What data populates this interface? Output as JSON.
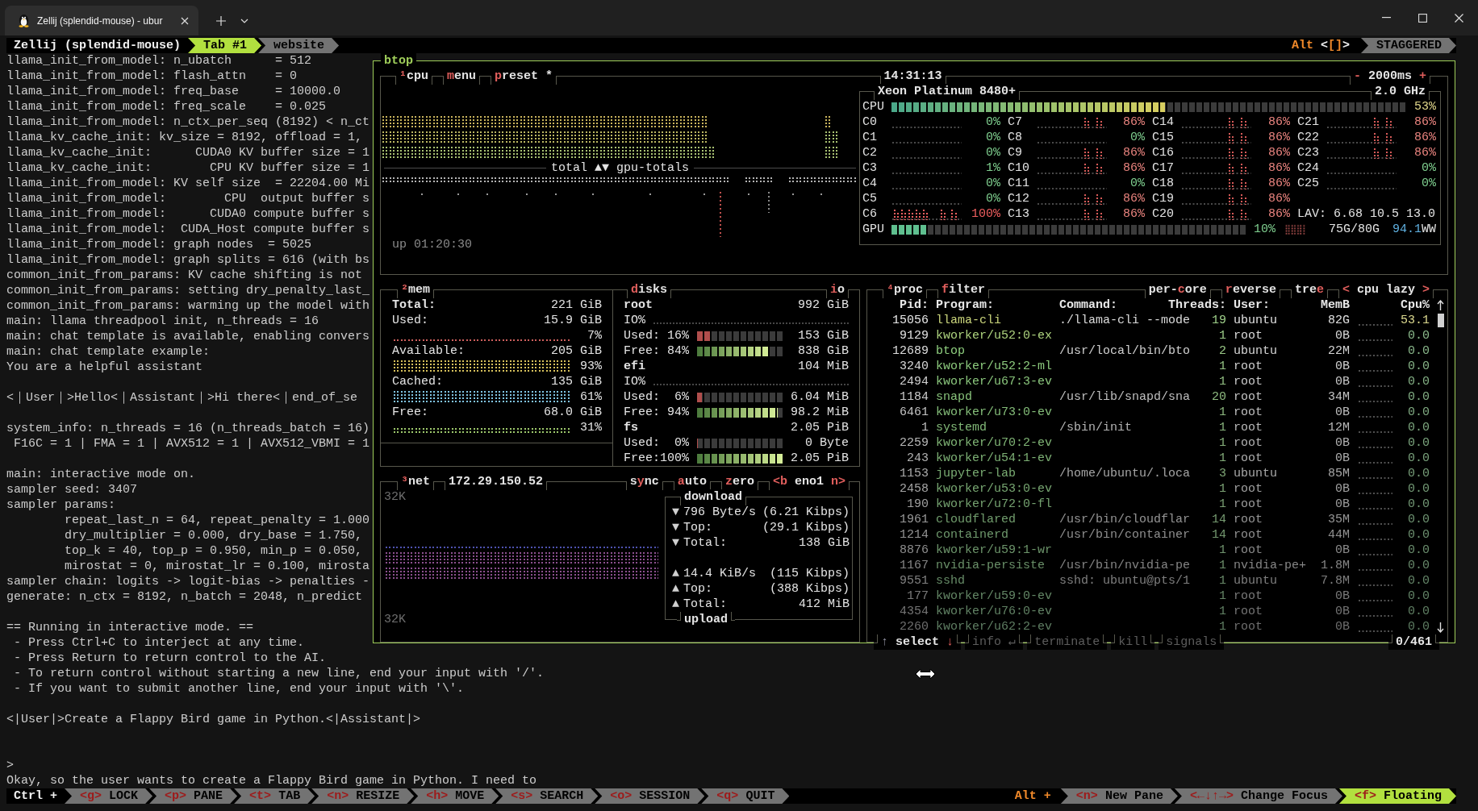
{
  "window": {
    "tab_title": "Zellij (splendid-mouse) - ubur"
  },
  "tab_bar": {
    "session": "Zellij (splendid-mouse)",
    "tabs": [
      {
        "label": "Tab #1",
        "selected": true
      },
      {
        "label": "website",
        "selected": false
      }
    ],
    "mode": "Alt",
    "swap_hint": [
      {
        "text": "<",
        "kind": "bracket"
      },
      {
        "text": "[]",
        "kind": "key"
      },
      {
        "text": ">",
        "kind": "bracket"
      }
    ],
    "layout": "STAGGERED"
  },
  "terminal": {
    "lines": [
      {
        "kind": "text",
        "text": "llama_init_from_model: n_ubatch      = 512"
      },
      {
        "kind": "text",
        "text": "llama_init_from_model: flash_attn    = 0"
      },
      {
        "kind": "text",
        "text": "llama_init_from_model: freq_base     = 10000.0"
      },
      {
        "kind": "text",
        "text": "llama_init_from_model: freq_scale    = 0.025"
      },
      {
        "kind": "text",
        "text": "llama_init_from_model: n_ctx_per_seq (8192) < n_ct"
      },
      {
        "kind": "text",
        "text": "llama_kv_cache_init: kv_size = 8192, offload = 1,"
      },
      {
        "kind": "text",
        "text": "llama_kv_cache_init:      CUDA0 KV buffer size = 1"
      },
      {
        "kind": "text",
        "text": "llama_kv_cache_init:        CPU KV buffer size = 1"
      },
      {
        "kind": "text",
        "text": "llama_init_from_model: KV self size  = 22204.00 Mi"
      },
      {
        "kind": "text",
        "text": "llama_init_from_model:        CPU  output buffer s"
      },
      {
        "kind": "text",
        "text": "llama_init_from_model:      CUDA0 compute buffer s"
      },
      {
        "kind": "text",
        "text": "llama_init_from_model:  CUDA_Host compute buffer s"
      },
      {
        "kind": "text",
        "text": "llama_init_from_model: graph nodes  = 5025"
      },
      {
        "kind": "text",
        "text": "llama_init_from_model: graph splits = 616 (with bs"
      },
      {
        "kind": "text",
        "text": "common_init_from_params: KV cache shifting is not"
      },
      {
        "kind": "text",
        "text": "common_init_from_params: setting dry_penalty_last_"
      },
      {
        "kind": "text",
        "text": "common_init_from_params: warming up the model with"
      },
      {
        "kind": "text",
        "text": "main: llama threadpool init, n_threads = 16"
      },
      {
        "kind": "text",
        "text": "main: chat template is available, enabling convers"
      },
      {
        "kind": "text",
        "text": "main: chat template example:"
      },
      {
        "kind": "text",
        "text": "You are a helpful assistant"
      },
      {
        "kind": "blank"
      },
      {
        "kind": "text",
        "text": "<｜User｜>Hello<｜Assistant｜>Hi there<｜end_of_se"
      },
      {
        "kind": "blank"
      },
      {
        "kind": "text",
        "text": "system_info: n_threads = 16 (n_threads_batch = 16)"
      },
      {
        "kind": "text",
        "text": " F16C = 1 | FMA = 1 | AVX512 = 1 | AVX512_VBMI = 1"
      },
      {
        "kind": "blank"
      },
      {
        "kind": "text",
        "text": "main: interactive mode on."
      },
      {
        "kind": "text",
        "text": "sampler seed: 3407"
      },
      {
        "kind": "text",
        "text": "sampler params:"
      },
      {
        "kind": "text",
        "text": "        repeat_last_n = 64, repeat_penalty = 1.000"
      },
      {
        "kind": "text",
        "text": "        dry_multiplier = 0.000, dry_base = 1.750,"
      },
      {
        "kind": "text",
        "text": "        top_k = 40, top_p = 0.950, min_p = 0.050,"
      },
      {
        "kind": "text",
        "text": "        mirostat = 0, mirostat_lr = 0.100, mirosta"
      },
      {
        "kind": "text",
        "text": "sampler chain: logits -> logit-bias -> penalties -"
      },
      {
        "kind": "text",
        "text": "generate: n_ctx = 8192, n_batch = 2048, n_predict"
      },
      {
        "kind": "blank"
      },
      {
        "kind": "text",
        "text": "== Running in interactive mode. =="
      },
      {
        "kind": "text",
        "text": " - Press Ctrl+C to interject at any time."
      },
      {
        "kind": "text",
        "text": " - Press Return to return control to the AI."
      },
      {
        "kind": "text",
        "text": " - To return control without starting a new line, end your input with '/'."
      },
      {
        "kind": "text",
        "text": " - If you want to submit another line, end your input with '\\'."
      },
      {
        "kind": "blank"
      },
      {
        "kind": "text",
        "text": "<|User|>Create a Flappy Bird game in Python.<|Assistant|>"
      },
      {
        "kind": "blank"
      },
      {
        "kind": "blank"
      },
      {
        "kind": "text",
        "text": ">"
      },
      {
        "kind": "text",
        "text": "Okay, so the user wants to create a Flappy Bird game in Python. I need to"
      }
    ]
  },
  "btop": {
    "title": "btop",
    "cpu": {
      "title": {
        "hotkey": "¹",
        "after": "cpu"
      },
      "menus": [
        {
          "hotkey": "m",
          "after": "enu"
        },
        {
          "hotkey": "p",
          "after": "reset *"
        }
      ],
      "clock": "14:31:13",
      "interval": {
        "minus": "-",
        "value": "2000ms",
        "plus": "+"
      },
      "graph_label": "total ▲▼ gpu-totals",
      "uptime": "up 01:20:30",
      "model": "Xeon Platinum 8480+",
      "frequency": "2.0 GHz",
      "total": {
        "label": "CPU",
        "level": 0.53,
        "reading": "53%"
      },
      "cores": [
        {
          "name": "C0",
          "reading": "0%",
          "kind": "idle"
        },
        {
          "name": "C1",
          "reading": "0%",
          "kind": "idle"
        },
        {
          "name": "C2",
          "reading": "0%",
          "kind": "idle"
        },
        {
          "name": "C3",
          "reading": "1%",
          "kind": "idle"
        },
        {
          "name": "C4",
          "reading": "0%",
          "kind": "idle"
        },
        {
          "name": "C5",
          "reading": "0%",
          "kind": "idle"
        },
        {
          "name": "C6",
          "reading": "100%",
          "kind": "full"
        },
        {
          "name": "C7",
          "reading": "86%",
          "kind": "busy"
        },
        {
          "name": "C8",
          "reading": "0%",
          "kind": "idle"
        },
        {
          "name": "C9",
          "reading": "86%",
          "kind": "busy"
        },
        {
          "name": "C10",
          "reading": "86%",
          "kind": "busy"
        },
        {
          "name": "C11",
          "reading": "0%",
          "kind": "idle"
        },
        {
          "name": "C12",
          "reading": "86%",
          "kind": "busy"
        },
        {
          "name": "C13",
          "reading": "86%",
          "kind": "busy"
        },
        {
          "name": "C14",
          "reading": "86%",
          "kind": "busy"
        },
        {
          "name": "C15",
          "reading": "86%",
          "kind": "busy"
        },
        {
          "name": "C16",
          "reading": "86%",
          "kind": "busy"
        },
        {
          "name": "C17",
          "reading": "86%",
          "kind": "busy"
        },
        {
          "name": "C18",
          "reading": "86%",
          "kind": "busy"
        },
        {
          "name": "C19",
          "reading": "86%",
          "kind": "busy"
        },
        {
          "name": "C20",
          "reading": "86%",
          "kind": "busy"
        },
        {
          "name": "C21",
          "reading": "86%",
          "kind": "busy"
        },
        {
          "name": "C22",
          "reading": "86%",
          "kind": "busy"
        },
        {
          "name": "C23",
          "reading": "86%",
          "kind": "busy"
        },
        {
          "name": "C24",
          "reading": "0%",
          "kind": "idle"
        },
        {
          "name": "C25",
          "reading": "0%",
          "kind": "idle"
        }
      ],
      "load_avg": "LAV: 6.68 10.5 13.0",
      "gpu": {
        "label": "GPU",
        "level": 0.1,
        "reading": "10%",
        "memory": "75G/80G",
        "power": "94.1",
        "power_unit": "WW"
      }
    },
    "mem": {
      "title": {
        "hotkey": "²",
        "after": "mem"
      },
      "items": [
        {
          "label": "Total:",
          "value": "221 GiB"
        },
        {
          "label": "Used:",
          "value": "15.9 GiB",
          "meter": {
            "reading": "7%",
            "kind": "low",
            "color": "#d0605e"
          }
        },
        {
          "label": "Available:",
          "value": "205 GiB",
          "meter": {
            "reading": "93%",
            "kind": "high",
            "color": "#d8c25c"
          }
        },
        {
          "label": "Cached:",
          "value": "135 GiB",
          "meter": {
            "reading": "61%",
            "kind": "high",
            "color": "#80c4e2"
          }
        },
        {
          "label": "Free:",
          "value": "68.0 GiB",
          "meter": {
            "reading": "31%",
            "kind": "mid",
            "color": "#9dc86c"
          }
        }
      ]
    },
    "disks": {
      "title": {
        "hotkey": "d",
        "after": "isks"
      },
      "io_toggle": {
        "hotkey": "i",
        "after": "o"
      },
      "items": [
        {
          "name": "root",
          "size": "992 GiB",
          "io_label": "IO%",
          "bars": [
            {
              "kind": "used",
              "label": "Used:",
              "reading": "16%",
              "level": 0.16,
              "value": "153 GiB"
            },
            {
              "kind": "free",
              "label": "Free:",
              "reading": "84%",
              "level": 0.84,
              "value": "838 GiB"
            }
          ]
        },
        {
          "name": "efi",
          "size": "104 MiB",
          "io_label": "IO%",
          "bars": [
            {
              "kind": "used",
              "label": "Used:",
              "reading": "6%",
              "level": 0.06,
              "value": "6.04 MiB"
            },
            {
              "kind": "free",
              "label": "Free:",
              "reading": "94%",
              "level": 0.94,
              "value": "98.2 MiB"
            }
          ]
        },
        {
          "name": "fs",
          "size": "2.05 PiB",
          "bars": [
            {
              "kind": "used",
              "label": "Used:",
              "reading": "0%",
              "level": 0,
              "value": "0 Byte"
            },
            {
              "kind": "free",
              "label": "Free:",
              "reading": "100%",
              "level": 1,
              "value": "2.05 PiB"
            }
          ]
        }
      ]
    },
    "net": {
      "title": {
        "hotkey": "³",
        "after": "net"
      },
      "address": "172.29.150.52",
      "toggles": [
        {
          "before": "s",
          "hotkey": "y",
          "after": "nc"
        },
        {
          "hotkey": "a",
          "after": "uto"
        },
        {
          "hotkey": "z",
          "after": "ero"
        }
      ],
      "interface": {
        "prev": "<b",
        "name": "eno1",
        "next": "n>"
      },
      "scale_top": "32K",
      "scale_bottom": "32K",
      "download": {
        "title": "download",
        "rows": [
          {
            "marker": "▼",
            "label": "796 Byte/s",
            "value": "(6.21 Kibps)"
          },
          {
            "marker": "▼",
            "label": "Top:",
            "value": "(29.1 Kibps)"
          },
          {
            "marker": "▼",
            "label": "Total:",
            "value": "138 GiB"
          }
        ]
      },
      "upload": {
        "title": "upload",
        "rows": [
          {
            "marker": "▲",
            "label": "14.4 KiB/s",
            "value": "(115 Kibps)"
          },
          {
            "marker": "▲",
            "label": "Top:",
            "value": "(388 Kibps)"
          },
          {
            "marker": "▲",
            "label": "Total:",
            "value": "412 MiB"
          }
        ]
      }
    },
    "proc": {
      "title": {
        "hotkey": "⁴",
        "after": "proc"
      },
      "filter": {
        "hotkey": "f",
        "after": "ilter"
      },
      "options": [
        {
          "before": "per-",
          "hotkey": "c",
          "after": "ore"
        },
        {
          "hotkey": "r",
          "after": "everse"
        },
        {
          "before": "tre",
          "hotkey": "e"
        }
      ],
      "sort": {
        "prev": "<",
        "label": "cpu lazy",
        "next": ">"
      },
      "columns": [
        "Pid:",
        "Program:",
        "Command:",
        "Threads:",
        "User:",
        "MemB",
        "Cpu%"
      ],
      "rows": [
        {
          "pid": "15056",
          "program": "llama-cli",
          "command": "./llama-cli --mode",
          "threads": "19",
          "user": "ubuntu",
          "mem": "82G",
          "cpu": "53.1"
        },
        {
          "pid": "9129",
          "program": "kworker/u52:0-ex",
          "threads": "1",
          "user": "root",
          "mem": "0B",
          "cpu": "0.0"
        },
        {
          "pid": "12689",
          "program": "btop",
          "command": "/usr/local/bin/bto",
          "threads": "2",
          "user": "ubuntu",
          "mem": "22M",
          "cpu": "0.0"
        },
        {
          "pid": "3240",
          "program": "kworker/u52:2-ml",
          "threads": "1",
          "user": "root",
          "mem": "0B",
          "cpu": "0.0"
        },
        {
          "pid": "2494",
          "program": "kworker/u67:3-ev",
          "threads": "1",
          "user": "root",
          "mem": "0B",
          "cpu": "0.0"
        },
        {
          "pid": "1184",
          "program": "snapd",
          "command": "/usr/lib/snapd/sna",
          "threads": "20",
          "user": "root",
          "mem": "34M",
          "cpu": "0.0"
        },
        {
          "pid": "6461",
          "program": "kworker/u73:0-ev",
          "threads": "1",
          "user": "root",
          "mem": "0B",
          "cpu": "0.0"
        },
        {
          "pid": "1",
          "program": "systemd",
          "command": "/sbin/init",
          "threads": "1",
          "user": "root",
          "mem": "12M",
          "cpu": "0.0"
        },
        {
          "pid": "2259",
          "program": "kworker/u70:2-ev",
          "threads": "1",
          "user": "root",
          "mem": "0B",
          "cpu": "0.0"
        },
        {
          "pid": "243",
          "program": "kworker/u54:1-ev",
          "threads": "1",
          "user": "root",
          "mem": "0B",
          "cpu": "0.0"
        },
        {
          "pid": "1153",
          "program": "jupyter-lab",
          "command": "/home/ubuntu/.loca",
          "threads": "3",
          "user": "ubuntu",
          "mem": "85M",
          "cpu": "0.0"
        },
        {
          "pid": "2458",
          "program": "kworker/u53:0-ev",
          "threads": "1",
          "user": "root",
          "mem": "0B",
          "cpu": "0.0"
        },
        {
          "pid": "190",
          "program": "kworker/u72:0-fl",
          "threads": "1",
          "user": "root",
          "mem": "0B",
          "cpu": "0.0"
        },
        {
          "pid": "1961",
          "program": "cloudflared",
          "command": "/usr/bin/cloudflar",
          "threads": "14",
          "user": "root",
          "mem": "35M",
          "cpu": "0.0"
        },
        {
          "pid": "1214",
          "program": "containerd",
          "command": "/usr/bin/container",
          "threads": "14",
          "user": "root",
          "mem": "44M",
          "cpu": "0.0"
        },
        {
          "pid": "8876",
          "program": "kworker/u59:1-wr",
          "threads": "1",
          "user": "root",
          "mem": "0B",
          "cpu": "0.0"
        },
        {
          "pid": "1167",
          "program": "nvidia-persiste",
          "command": "/usr/bin/nvidia-pe",
          "threads": "1",
          "user": "nvidia-pe+",
          "mem": "1.8M",
          "cpu": "0.0"
        },
        {
          "pid": "9551",
          "program": "sshd",
          "command": "sshd: ubuntu@pts/1",
          "threads": "1",
          "user": "ubuntu",
          "mem": "7.8M",
          "cpu": "0.0"
        },
        {
          "pid": "177",
          "program": "kworker/u59:0-ev",
          "threads": "1",
          "user": "root",
          "mem": "0B",
          "cpu": "0.0"
        },
        {
          "pid": "4354",
          "program": "kworker/u76:0-ev",
          "threads": "1",
          "user": "root",
          "mem": "0B",
          "cpu": "0.0"
        },
        {
          "pid": "2260",
          "program": "kworker/u62:2-ev",
          "threads": "1",
          "user": "root",
          "mem": "0B",
          "cpu": "0.0"
        }
      ],
      "select": {
        "up": "↑",
        "label": "select",
        "down": "↓"
      },
      "actions": [
        {
          "label": "info",
          "key": "↵",
          "disabled": true
        },
        {
          "label": "terminate",
          "disabled": true
        },
        {
          "label": "kill",
          "disabled": true
        },
        {
          "label": "signals",
          "disabled": true
        }
      ],
      "count": "0/461"
    }
  },
  "status_bar": {
    "ctrl_label": "Ctrl +",
    "modes": [
      {
        "key": "<g>",
        "label": "LOCK",
        "selected": false
      },
      {
        "key": "<p>",
        "label": "PANE",
        "selected": false
      },
      {
        "key": "<t>",
        "label": "TAB",
        "selected": false
      },
      {
        "key": "<n>",
        "label": "RESIZE",
        "selected": false
      },
      {
        "key": "<h>",
        "label": "MOVE",
        "selected": false
      },
      {
        "key": "<s>",
        "label": "SEARCH",
        "selected": false
      },
      {
        "key": "<o>",
        "label": "SESSION",
        "selected": false
      },
      {
        "key": "<q>",
        "label": "QUIT",
        "selected": false
      }
    ],
    "alt_label": "Alt +",
    "actions": [
      {
        "key": "<n>",
        "label": "New Pane",
        "selected": false
      },
      {
        "key": "<←↓↑→>",
        "label": "Change Focus",
        "selected": false
      },
      {
        "key": "<f>",
        "label": "Floating",
        "selected": true
      }
    ]
  }
}
